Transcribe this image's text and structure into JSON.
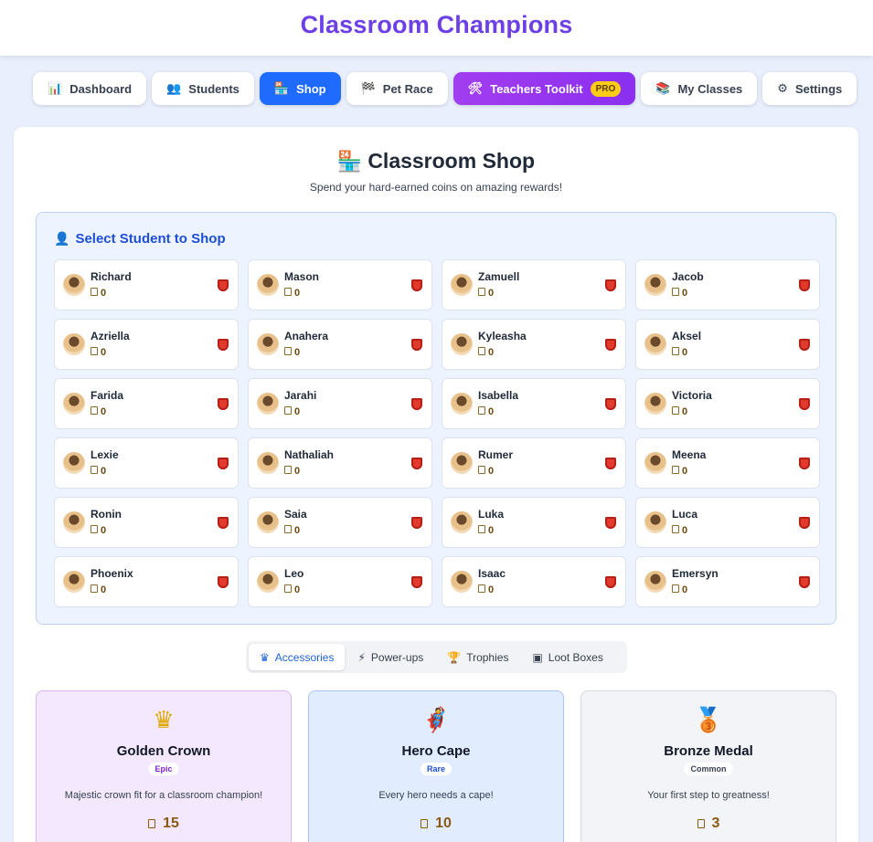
{
  "app": {
    "title": "Classroom Champions"
  },
  "nav": [
    {
      "icon": "bar-chart-icon",
      "glyph": "📊",
      "label": "Dashboard"
    },
    {
      "icon": "users-icon",
      "glyph": "👥",
      "label": "Students"
    },
    {
      "icon": "shop-icon",
      "glyph": "🏪",
      "label": "Shop",
      "active": true
    },
    {
      "icon": "flag-icon",
      "glyph": "🏁",
      "label": "Pet Race"
    },
    {
      "icon": "tools-icon",
      "glyph": "🛠",
      "label": "Teachers Toolkit",
      "badge": "PRO"
    },
    {
      "icon": "books-icon",
      "glyph": "📚",
      "label": "My Classes"
    },
    {
      "icon": "gear-icon",
      "glyph": "⚙",
      "label": "Settings"
    }
  ],
  "shop": {
    "icon": "shop-icon",
    "glyph": "🏪",
    "title": "Classroom Shop",
    "subtitle": "Spend your hard-earned coins on amazing rewards!"
  },
  "select": {
    "icon": "person-icon",
    "glyph": "👤",
    "heading": "Select Student to Shop"
  },
  "students": [
    {
      "name": "Richard",
      "coins": "0"
    },
    {
      "name": "Mason",
      "coins": "0"
    },
    {
      "name": "Zamuell",
      "coins": "0"
    },
    {
      "name": "Jacob",
      "coins": "0"
    },
    {
      "name": "Azriella",
      "coins": "0"
    },
    {
      "name": "Anahera",
      "coins": "0"
    },
    {
      "name": "Kyleasha",
      "coins": "0"
    },
    {
      "name": "Aksel",
      "coins": "0"
    },
    {
      "name": "Farida",
      "coins": "0"
    },
    {
      "name": "Jarahi",
      "coins": "0"
    },
    {
      "name": "Isabella",
      "coins": "0"
    },
    {
      "name": "Victoria",
      "coins": "0"
    },
    {
      "name": "Lexie",
      "coins": "0"
    },
    {
      "name": "Nathaliah",
      "coins": "0"
    },
    {
      "name": "Rumer",
      "coins": "0"
    },
    {
      "name": "Meena",
      "coins": "0"
    },
    {
      "name": "Ronin",
      "coins": "0"
    },
    {
      "name": "Saia",
      "coins": "0"
    },
    {
      "name": "Luka",
      "coins": "0"
    },
    {
      "name": "Luca",
      "coins": "0"
    },
    {
      "name": "Phoenix",
      "coins": "0"
    },
    {
      "name": "Leo",
      "coins": "0"
    },
    {
      "name": "Isaac",
      "coins": "0"
    },
    {
      "name": "Emersyn",
      "coins": "0"
    }
  ],
  "tabs": [
    {
      "icon": "crown-icon",
      "glyph": "♛",
      "label": "Accessories",
      "active": true
    },
    {
      "icon": "lightning-icon",
      "glyph": "⚡",
      "label": "Power-ups"
    },
    {
      "icon": "trophy-icon",
      "glyph": "🏆",
      "label": "Trophies"
    },
    {
      "icon": "loot-box-icon",
      "glyph": "▣",
      "label": "Loot Boxes"
    }
  ],
  "items": [
    {
      "icon": "crown-icon",
      "glyph": "♛",
      "name": "Golden Crown",
      "rarity": "Epic",
      "description": "Majestic crown fit for a classroom champion!",
      "price": "15",
      "tier": "epic",
      "icon_color": "#e0a800"
    },
    {
      "icon": "superhero-icon",
      "glyph": "🦸",
      "name": "Hero Cape",
      "rarity": "Rare",
      "description": "Every hero needs a cape!",
      "price": "10",
      "tier": "rare",
      "icon_color": "#c2410c"
    },
    {
      "icon": "medal-icon",
      "glyph": "🥉",
      "name": "Bronze Medal",
      "rarity": "Common",
      "description": "Your first step to greatness!",
      "price": "3",
      "tier": "common",
      "icon_color": "#b45309"
    }
  ],
  "colors": {
    "brand": "#6d3fe6",
    "active_nav": "#1f6bff",
    "pro_gradient": "#a23df0",
    "select_heading": "#1d4ed8"
  }
}
